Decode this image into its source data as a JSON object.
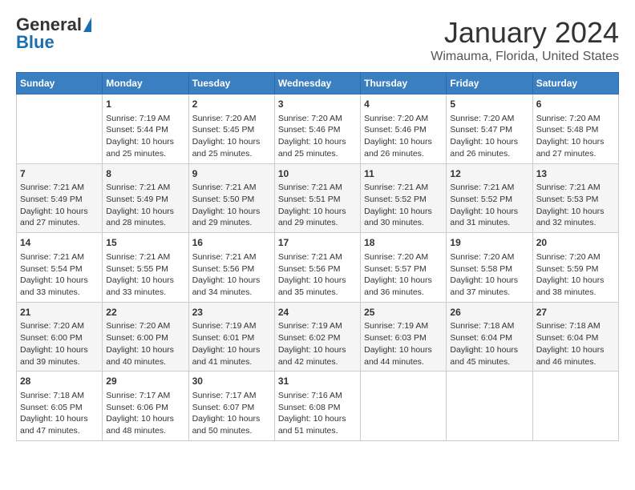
{
  "header": {
    "logo_general": "General",
    "logo_blue": "Blue",
    "title": "January 2024",
    "subtitle": "Wimauma, Florida, United States"
  },
  "columns": [
    "Sunday",
    "Monday",
    "Tuesday",
    "Wednesday",
    "Thursday",
    "Friday",
    "Saturday"
  ],
  "weeks": [
    [
      {
        "day": "",
        "info": ""
      },
      {
        "day": "1",
        "info": "Sunrise: 7:19 AM\nSunset: 5:44 PM\nDaylight: 10 hours\nand 25 minutes."
      },
      {
        "day": "2",
        "info": "Sunrise: 7:20 AM\nSunset: 5:45 PM\nDaylight: 10 hours\nand 25 minutes."
      },
      {
        "day": "3",
        "info": "Sunrise: 7:20 AM\nSunset: 5:46 PM\nDaylight: 10 hours\nand 25 minutes."
      },
      {
        "day": "4",
        "info": "Sunrise: 7:20 AM\nSunset: 5:46 PM\nDaylight: 10 hours\nand 26 minutes."
      },
      {
        "day": "5",
        "info": "Sunrise: 7:20 AM\nSunset: 5:47 PM\nDaylight: 10 hours\nand 26 minutes."
      },
      {
        "day": "6",
        "info": "Sunrise: 7:20 AM\nSunset: 5:48 PM\nDaylight: 10 hours\nand 27 minutes."
      }
    ],
    [
      {
        "day": "7",
        "info": "Sunrise: 7:21 AM\nSunset: 5:49 PM\nDaylight: 10 hours\nand 27 minutes."
      },
      {
        "day": "8",
        "info": "Sunrise: 7:21 AM\nSunset: 5:49 PM\nDaylight: 10 hours\nand 28 minutes."
      },
      {
        "day": "9",
        "info": "Sunrise: 7:21 AM\nSunset: 5:50 PM\nDaylight: 10 hours\nand 29 minutes."
      },
      {
        "day": "10",
        "info": "Sunrise: 7:21 AM\nSunset: 5:51 PM\nDaylight: 10 hours\nand 29 minutes."
      },
      {
        "day": "11",
        "info": "Sunrise: 7:21 AM\nSunset: 5:52 PM\nDaylight: 10 hours\nand 30 minutes."
      },
      {
        "day": "12",
        "info": "Sunrise: 7:21 AM\nSunset: 5:52 PM\nDaylight: 10 hours\nand 31 minutes."
      },
      {
        "day": "13",
        "info": "Sunrise: 7:21 AM\nSunset: 5:53 PM\nDaylight: 10 hours\nand 32 minutes."
      }
    ],
    [
      {
        "day": "14",
        "info": "Sunrise: 7:21 AM\nSunset: 5:54 PM\nDaylight: 10 hours\nand 33 minutes."
      },
      {
        "day": "15",
        "info": "Sunrise: 7:21 AM\nSunset: 5:55 PM\nDaylight: 10 hours\nand 33 minutes."
      },
      {
        "day": "16",
        "info": "Sunrise: 7:21 AM\nSunset: 5:56 PM\nDaylight: 10 hours\nand 34 minutes."
      },
      {
        "day": "17",
        "info": "Sunrise: 7:21 AM\nSunset: 5:56 PM\nDaylight: 10 hours\nand 35 minutes."
      },
      {
        "day": "18",
        "info": "Sunrise: 7:20 AM\nSunset: 5:57 PM\nDaylight: 10 hours\nand 36 minutes."
      },
      {
        "day": "19",
        "info": "Sunrise: 7:20 AM\nSunset: 5:58 PM\nDaylight: 10 hours\nand 37 minutes."
      },
      {
        "day": "20",
        "info": "Sunrise: 7:20 AM\nSunset: 5:59 PM\nDaylight: 10 hours\nand 38 minutes."
      }
    ],
    [
      {
        "day": "21",
        "info": "Sunrise: 7:20 AM\nSunset: 6:00 PM\nDaylight: 10 hours\nand 39 minutes."
      },
      {
        "day": "22",
        "info": "Sunrise: 7:20 AM\nSunset: 6:00 PM\nDaylight: 10 hours\nand 40 minutes."
      },
      {
        "day": "23",
        "info": "Sunrise: 7:19 AM\nSunset: 6:01 PM\nDaylight: 10 hours\nand 41 minutes."
      },
      {
        "day": "24",
        "info": "Sunrise: 7:19 AM\nSunset: 6:02 PM\nDaylight: 10 hours\nand 42 minutes."
      },
      {
        "day": "25",
        "info": "Sunrise: 7:19 AM\nSunset: 6:03 PM\nDaylight: 10 hours\nand 44 minutes."
      },
      {
        "day": "26",
        "info": "Sunrise: 7:18 AM\nSunset: 6:04 PM\nDaylight: 10 hours\nand 45 minutes."
      },
      {
        "day": "27",
        "info": "Sunrise: 7:18 AM\nSunset: 6:04 PM\nDaylight: 10 hours\nand 46 minutes."
      }
    ],
    [
      {
        "day": "28",
        "info": "Sunrise: 7:18 AM\nSunset: 6:05 PM\nDaylight: 10 hours\nand 47 minutes."
      },
      {
        "day": "29",
        "info": "Sunrise: 7:17 AM\nSunset: 6:06 PM\nDaylight: 10 hours\nand 48 minutes."
      },
      {
        "day": "30",
        "info": "Sunrise: 7:17 AM\nSunset: 6:07 PM\nDaylight: 10 hours\nand 50 minutes."
      },
      {
        "day": "31",
        "info": "Sunrise: 7:16 AM\nSunset: 6:08 PM\nDaylight: 10 hours\nand 51 minutes."
      },
      {
        "day": "",
        "info": ""
      },
      {
        "day": "",
        "info": ""
      },
      {
        "day": "",
        "info": ""
      }
    ]
  ]
}
